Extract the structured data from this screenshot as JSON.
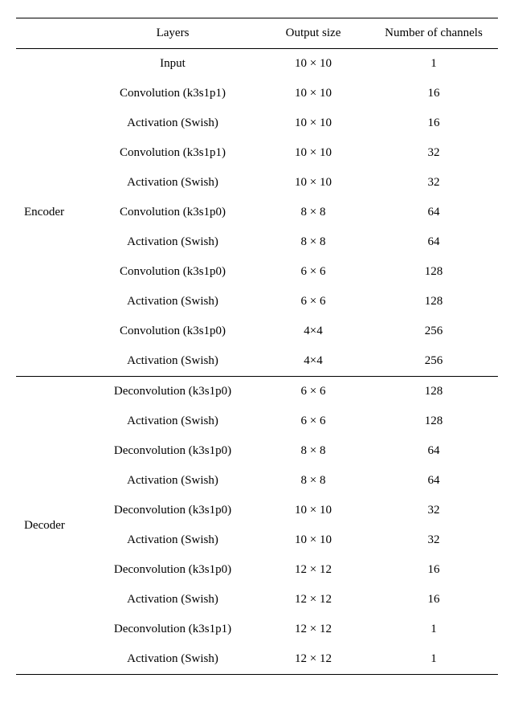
{
  "headers": {
    "section": "",
    "layers": "Layers",
    "output_size": "Output size",
    "channels": "Number of channels"
  },
  "sections": [
    {
      "name": "Encoder",
      "rows": [
        {
          "layer": "Input",
          "size": "10 × 10",
          "channels": "1"
        },
        {
          "layer": "Convolution (k3s1p1)",
          "size": "10 × 10",
          "channels": "16"
        },
        {
          "layer": "Activation (Swish)",
          "size": "10 × 10",
          "channels": "16"
        },
        {
          "layer": "Convolution (k3s1p1)",
          "size": "10 × 10",
          "channels": "32"
        },
        {
          "layer": "Activation (Swish)",
          "size": "10 × 10",
          "channels": "32"
        },
        {
          "layer": "Convolution (k3s1p0)",
          "size": "8 × 8",
          "channels": "64"
        },
        {
          "layer": "Activation (Swish)",
          "size": "8 × 8",
          "channels": "64"
        },
        {
          "layer": "Convolution (k3s1p0)",
          "size": "6 × 6",
          "channels": "128"
        },
        {
          "layer": "Activation (Swish)",
          "size": "6 × 6",
          "channels": "128"
        },
        {
          "layer": "Convolution (k3s1p0)",
          "size": "4×4",
          "channels": "256"
        },
        {
          "layer": "Activation (Swish)",
          "size": "4×4",
          "channels": "256"
        }
      ]
    },
    {
      "name": "Decoder",
      "rows": [
        {
          "layer": "Deconvolution (k3s1p0)",
          "size": "6 × 6",
          "channels": "128"
        },
        {
          "layer": "Activation (Swish)",
          "size": "6 × 6",
          "channels": "128"
        },
        {
          "layer": "Deconvolution (k3s1p0)",
          "size": "8 × 8",
          "channels": "64"
        },
        {
          "layer": "Activation (Swish)",
          "size": "8 × 8",
          "channels": "64"
        },
        {
          "layer": "Deconvolution (k3s1p0)",
          "size": "10 × 10",
          "channels": "32"
        },
        {
          "layer": "Activation (Swish)",
          "size": "10 × 10",
          "channels": "32"
        },
        {
          "layer": "Deconvolution (k3s1p0)",
          "size": "12 × 12",
          "channels": "16"
        },
        {
          "layer": "Activation (Swish)",
          "size": "12 × 12",
          "channels": "16"
        },
        {
          "layer": "Deconvolution (k3s1p1)",
          "size": "12 × 12",
          "channels": "1"
        },
        {
          "layer": "Activation (Swish)",
          "size": "12 × 12",
          "channels": "1"
        }
      ]
    }
  ]
}
